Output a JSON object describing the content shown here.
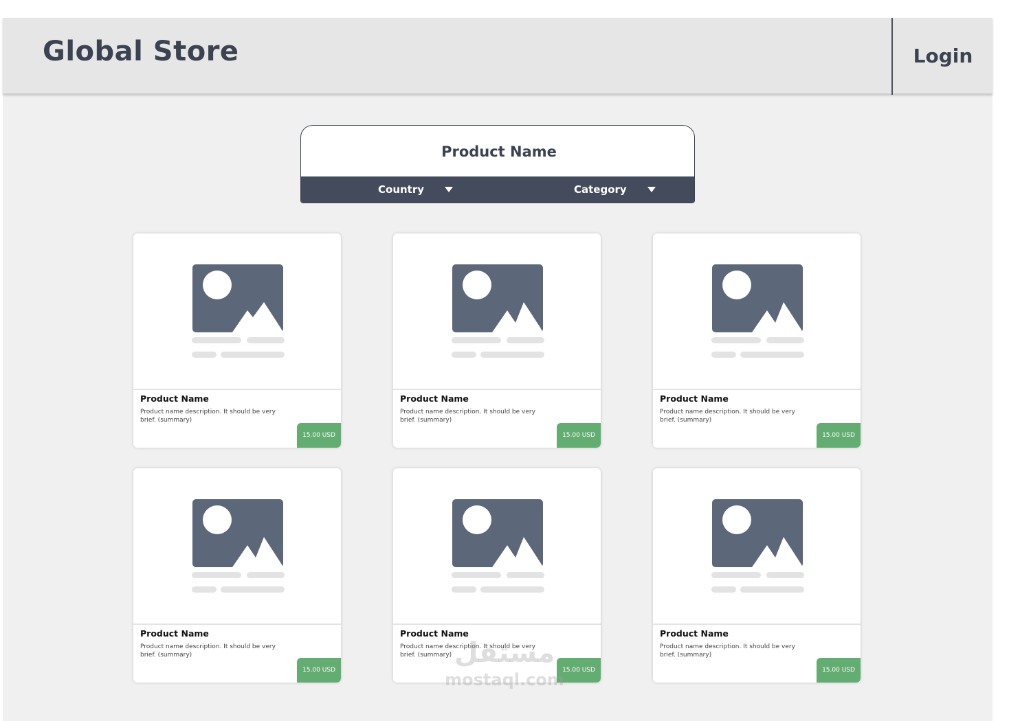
{
  "header": {
    "brand": "Global Store",
    "login_label": "Login"
  },
  "search": {
    "placeholder": "Product Name",
    "filters": [
      {
        "label": "Country"
      },
      {
        "label": "Category"
      }
    ]
  },
  "products": [
    {
      "name": "Product Name",
      "description": "Product name description. It should be very brief. (summary)",
      "price": "15.00 USD"
    },
    {
      "name": "Product Name",
      "description": "Product name description. It should be very brief. (summary)",
      "price": "15.00 USD"
    },
    {
      "name": "Product Name",
      "description": "Product name description. It should be very brief. (summary)",
      "price": "15.00 USD"
    },
    {
      "name": "Product Name",
      "description": "Product name description. It should be very brief. (summary)",
      "price": "15.00 USD"
    },
    {
      "name": "Product Name",
      "description": "Product name description. It should be very brief. (summary)",
      "price": "15.00 USD"
    },
    {
      "name": "Product Name",
      "description": "Product name description. It should be very brief. (summary)",
      "price": "15.00 USD"
    }
  ],
  "watermark": {
    "arabic": "مستقل",
    "site": "mostaql.com"
  },
  "colors": {
    "header_bg": "#e6e6e6",
    "page_bg": "#f0f0f0",
    "dark_accent": "#434b5c",
    "image_placeholder": "#5c6779",
    "price_badge": "#63ad72"
  }
}
